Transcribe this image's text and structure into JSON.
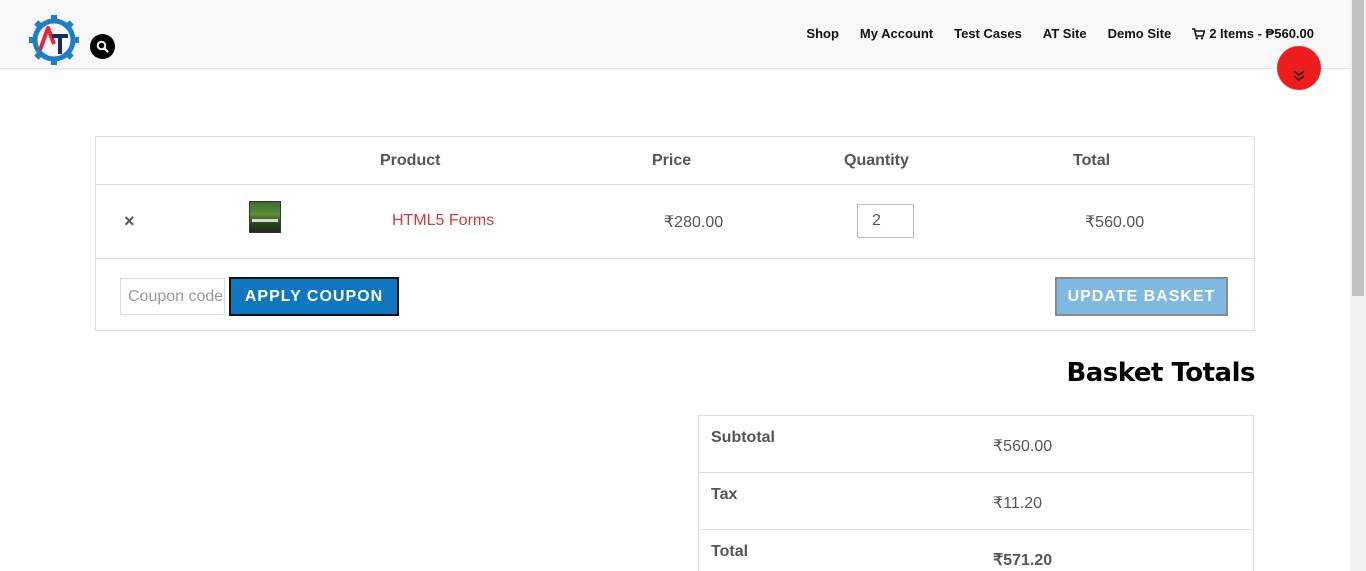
{
  "header": {
    "logo_letters": "AT",
    "nav": [
      "Shop",
      "My Account",
      "Test Cases",
      "AT Site",
      "Demo Site"
    ],
    "cart_summary": "2 Items - ₱560.00"
  },
  "cart": {
    "columns": [
      "Product",
      "Price",
      "Quantity",
      "Total"
    ],
    "items": [
      {
        "remove": "×",
        "name": "HTML5 Forms",
        "price": "₹280.00",
        "quantity": "2",
        "total": "₹560.00"
      }
    ],
    "coupon_placeholder": "Coupon code",
    "apply_label": "APPLY COUPON",
    "update_label": "UPDATE BASKET"
  },
  "totals": {
    "title": "Basket Totals",
    "rows": [
      {
        "label": "Subtotal",
        "value": "₹560.00"
      },
      {
        "label": "Tax",
        "value": "₹11.20"
      },
      {
        "label": "Total",
        "value": "₹571.20"
      }
    ]
  },
  "colors": {
    "accent_blue": "#0e77c0",
    "update_blue": "#7fb8e0",
    "product_link": "#d23b35",
    "scroll_circle": "#ee1c1c"
  },
  "icons": [
    "logo-gear-icon",
    "search-icon",
    "cart-icon",
    "remove-icon",
    "chevron-double-down-icon"
  ]
}
